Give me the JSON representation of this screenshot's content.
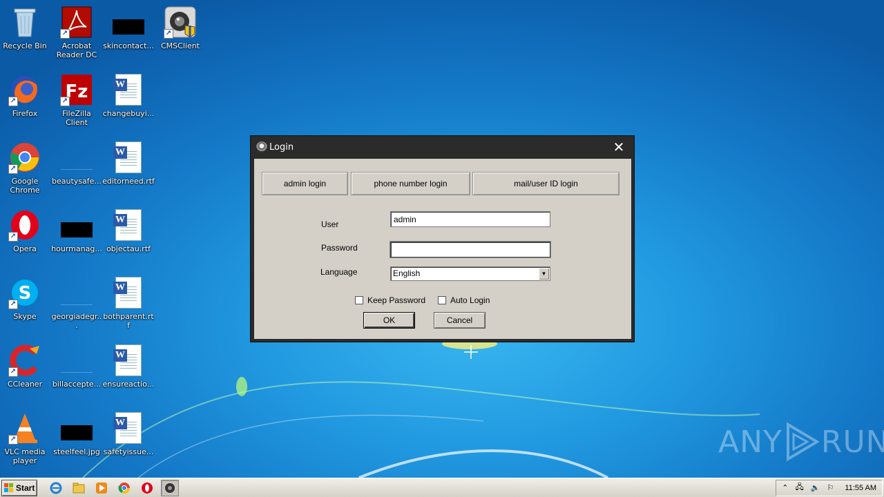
{
  "desktop": {
    "icons": [
      {
        "label": "Recycle Bin"
      },
      {
        "label": "Acrobat Reader DC"
      },
      {
        "label": "skincontact..."
      },
      {
        "label": "CMSClient"
      },
      {
        "label": "Firefox"
      },
      {
        "label": "FileZilla Client"
      },
      {
        "label": "changebuyi..."
      },
      {
        "label": "Google Chrome"
      },
      {
        "label": "beautysafe..."
      },
      {
        "label": "editorneed.rtf"
      },
      {
        "label": "Opera"
      },
      {
        "label": "hourmanag..."
      },
      {
        "label": "objectau.rtf"
      },
      {
        "label": "Skype"
      },
      {
        "label": "georgiadegr..."
      },
      {
        "label": "bothparent.rtf"
      },
      {
        "label": "CCleaner"
      },
      {
        "label": "billaccepte..."
      },
      {
        "label": "ensureactio..."
      },
      {
        "label": "VLC media player"
      },
      {
        "label": "steelfeel.jpg"
      },
      {
        "label": "safetyissue..."
      }
    ]
  },
  "login": {
    "title": "Login",
    "close_glyph": "✕",
    "tabs": [
      "admin login",
      "phone number login",
      "mail/user ID login"
    ],
    "user_label": "User",
    "user_value": "admin",
    "password_label": "Password",
    "password_value": "",
    "language_label": "Language",
    "language_value": "English",
    "keep_password_label": "Keep Password",
    "auto_login_label": "Auto Login",
    "ok_label": "OK",
    "cancel_label": "Cancel"
  },
  "watermark": {
    "text_left": "ANY",
    "text_right": "RUN"
  },
  "taskbar": {
    "start_label": "Start",
    "clock": "11:55 AM"
  }
}
